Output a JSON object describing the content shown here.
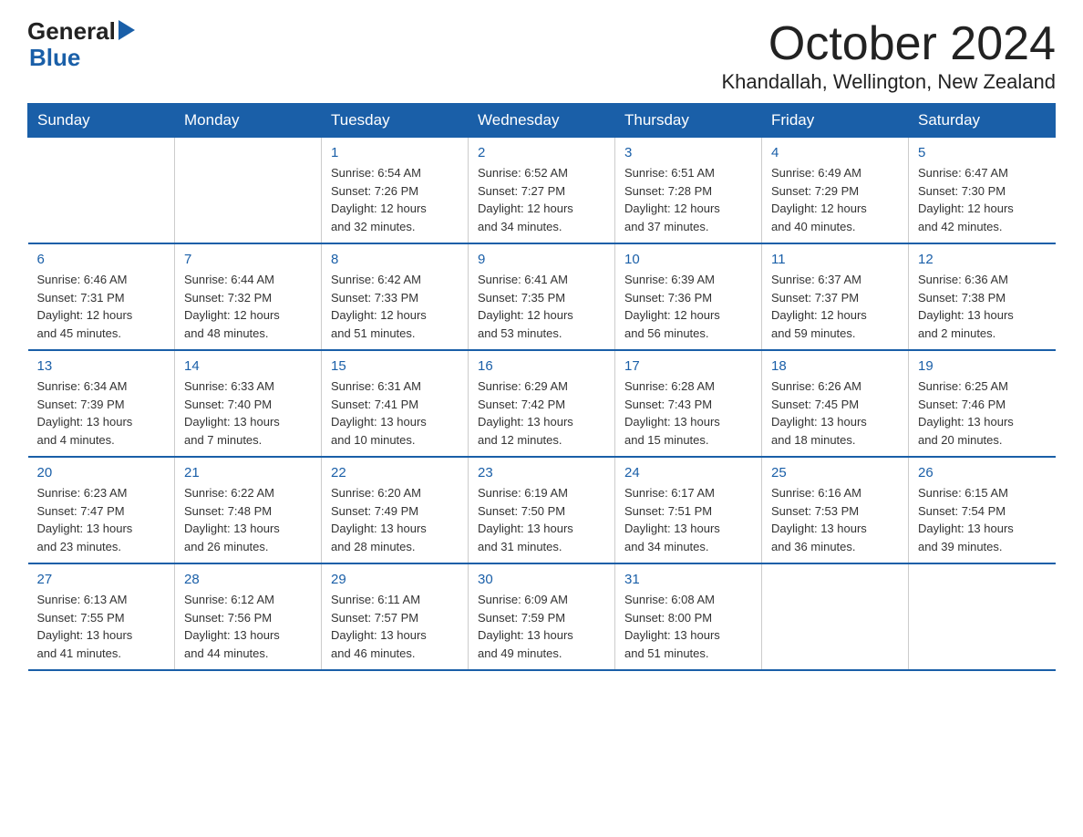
{
  "logo": {
    "text_general": "General",
    "text_blue": "Blue"
  },
  "title": "October 2024",
  "subtitle": "Khandallah, Wellington, New Zealand",
  "days_of_week": [
    "Sunday",
    "Monday",
    "Tuesday",
    "Wednesday",
    "Thursday",
    "Friday",
    "Saturday"
  ],
  "weeks": [
    [
      {
        "day": "",
        "info": ""
      },
      {
        "day": "",
        "info": ""
      },
      {
        "day": "1",
        "info": "Sunrise: 6:54 AM\nSunset: 7:26 PM\nDaylight: 12 hours\nand 32 minutes."
      },
      {
        "day": "2",
        "info": "Sunrise: 6:52 AM\nSunset: 7:27 PM\nDaylight: 12 hours\nand 34 minutes."
      },
      {
        "day": "3",
        "info": "Sunrise: 6:51 AM\nSunset: 7:28 PM\nDaylight: 12 hours\nand 37 minutes."
      },
      {
        "day": "4",
        "info": "Sunrise: 6:49 AM\nSunset: 7:29 PM\nDaylight: 12 hours\nand 40 minutes."
      },
      {
        "day": "5",
        "info": "Sunrise: 6:47 AM\nSunset: 7:30 PM\nDaylight: 12 hours\nand 42 minutes."
      }
    ],
    [
      {
        "day": "6",
        "info": "Sunrise: 6:46 AM\nSunset: 7:31 PM\nDaylight: 12 hours\nand 45 minutes."
      },
      {
        "day": "7",
        "info": "Sunrise: 6:44 AM\nSunset: 7:32 PM\nDaylight: 12 hours\nand 48 minutes."
      },
      {
        "day": "8",
        "info": "Sunrise: 6:42 AM\nSunset: 7:33 PM\nDaylight: 12 hours\nand 51 minutes."
      },
      {
        "day": "9",
        "info": "Sunrise: 6:41 AM\nSunset: 7:35 PM\nDaylight: 12 hours\nand 53 minutes."
      },
      {
        "day": "10",
        "info": "Sunrise: 6:39 AM\nSunset: 7:36 PM\nDaylight: 12 hours\nand 56 minutes."
      },
      {
        "day": "11",
        "info": "Sunrise: 6:37 AM\nSunset: 7:37 PM\nDaylight: 12 hours\nand 59 minutes."
      },
      {
        "day": "12",
        "info": "Sunrise: 6:36 AM\nSunset: 7:38 PM\nDaylight: 13 hours\nand 2 minutes."
      }
    ],
    [
      {
        "day": "13",
        "info": "Sunrise: 6:34 AM\nSunset: 7:39 PM\nDaylight: 13 hours\nand 4 minutes."
      },
      {
        "day": "14",
        "info": "Sunrise: 6:33 AM\nSunset: 7:40 PM\nDaylight: 13 hours\nand 7 minutes."
      },
      {
        "day": "15",
        "info": "Sunrise: 6:31 AM\nSunset: 7:41 PM\nDaylight: 13 hours\nand 10 minutes."
      },
      {
        "day": "16",
        "info": "Sunrise: 6:29 AM\nSunset: 7:42 PM\nDaylight: 13 hours\nand 12 minutes."
      },
      {
        "day": "17",
        "info": "Sunrise: 6:28 AM\nSunset: 7:43 PM\nDaylight: 13 hours\nand 15 minutes."
      },
      {
        "day": "18",
        "info": "Sunrise: 6:26 AM\nSunset: 7:45 PM\nDaylight: 13 hours\nand 18 minutes."
      },
      {
        "day": "19",
        "info": "Sunrise: 6:25 AM\nSunset: 7:46 PM\nDaylight: 13 hours\nand 20 minutes."
      }
    ],
    [
      {
        "day": "20",
        "info": "Sunrise: 6:23 AM\nSunset: 7:47 PM\nDaylight: 13 hours\nand 23 minutes."
      },
      {
        "day": "21",
        "info": "Sunrise: 6:22 AM\nSunset: 7:48 PM\nDaylight: 13 hours\nand 26 minutes."
      },
      {
        "day": "22",
        "info": "Sunrise: 6:20 AM\nSunset: 7:49 PM\nDaylight: 13 hours\nand 28 minutes."
      },
      {
        "day": "23",
        "info": "Sunrise: 6:19 AM\nSunset: 7:50 PM\nDaylight: 13 hours\nand 31 minutes."
      },
      {
        "day": "24",
        "info": "Sunrise: 6:17 AM\nSunset: 7:51 PM\nDaylight: 13 hours\nand 34 minutes."
      },
      {
        "day": "25",
        "info": "Sunrise: 6:16 AM\nSunset: 7:53 PM\nDaylight: 13 hours\nand 36 minutes."
      },
      {
        "day": "26",
        "info": "Sunrise: 6:15 AM\nSunset: 7:54 PM\nDaylight: 13 hours\nand 39 minutes."
      }
    ],
    [
      {
        "day": "27",
        "info": "Sunrise: 6:13 AM\nSunset: 7:55 PM\nDaylight: 13 hours\nand 41 minutes."
      },
      {
        "day": "28",
        "info": "Sunrise: 6:12 AM\nSunset: 7:56 PM\nDaylight: 13 hours\nand 44 minutes."
      },
      {
        "day": "29",
        "info": "Sunrise: 6:11 AM\nSunset: 7:57 PM\nDaylight: 13 hours\nand 46 minutes."
      },
      {
        "day": "30",
        "info": "Sunrise: 6:09 AM\nSunset: 7:59 PM\nDaylight: 13 hours\nand 49 minutes."
      },
      {
        "day": "31",
        "info": "Sunrise: 6:08 AM\nSunset: 8:00 PM\nDaylight: 13 hours\nand 51 minutes."
      },
      {
        "day": "",
        "info": ""
      },
      {
        "day": "",
        "info": ""
      }
    ]
  ]
}
